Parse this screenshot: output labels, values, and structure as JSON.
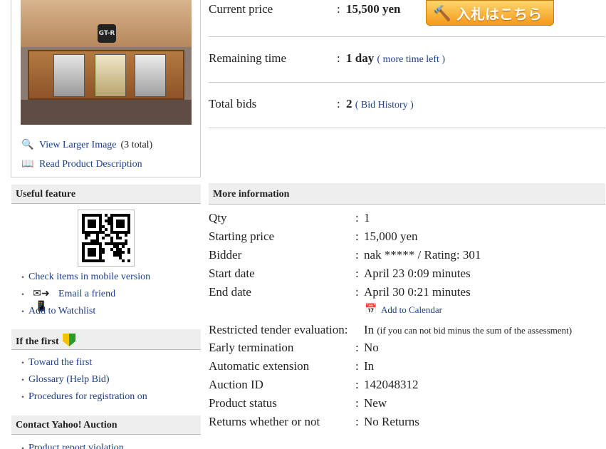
{
  "product": {
    "view_larger_label": "View Larger Image",
    "view_larger_count": "(3 total)",
    "read_description_label": "Read Product Description"
  },
  "price": {
    "label": "Current price",
    "value": "15,500 yen",
    "bid_button_label": "入札はこちら"
  },
  "remaining": {
    "label": "Remaining time",
    "value": "1 day",
    "link": "( more time left )"
  },
  "bids": {
    "label": "Total bids",
    "value": "2",
    "link": "( Bid History )"
  },
  "useful": {
    "heading": "Useful feature",
    "items": [
      "Check items in mobile version",
      "Email a friend",
      "Add to Watchlist"
    ]
  },
  "first": {
    "heading": "If the first",
    "items": [
      "Toward the first",
      "Glossary (Help Bid)",
      "Procedures for registration on"
    ]
  },
  "contact": {
    "heading": "Contact Yahoo! Auction",
    "items": [
      "Product report violation"
    ]
  },
  "more": {
    "heading": "More information",
    "add_calendar": "Add to Calendar",
    "rows": [
      {
        "label": "Qty",
        "value": "1"
      },
      {
        "label": "Starting price",
        "value": "15,000 yen"
      },
      {
        "label": "Bidder",
        "value": "nak ***** / Rating: 301"
      },
      {
        "label": "Start date",
        "value": "April 23 0:09 minutes"
      },
      {
        "label": "End date",
        "value": "April 30 0:21 minutes"
      },
      {
        "label": "Restricted tender evaluation:",
        "value": "In",
        "note": "(if you can not bid minus the sum of the assessment)"
      },
      {
        "label": "Early termination",
        "value": "No"
      },
      {
        "label": "Automatic extension",
        "value": "In"
      },
      {
        "label": "Auction ID",
        "value": "142048312"
      },
      {
        "label": "Product status",
        "value": "New"
      },
      {
        "label": "Returns whether or not",
        "value": "No Returns"
      }
    ]
  },
  "colors": {
    "link": "#1a3d8f",
    "section_bg": "#eeeeee",
    "bid_button": "#f39a1a"
  }
}
